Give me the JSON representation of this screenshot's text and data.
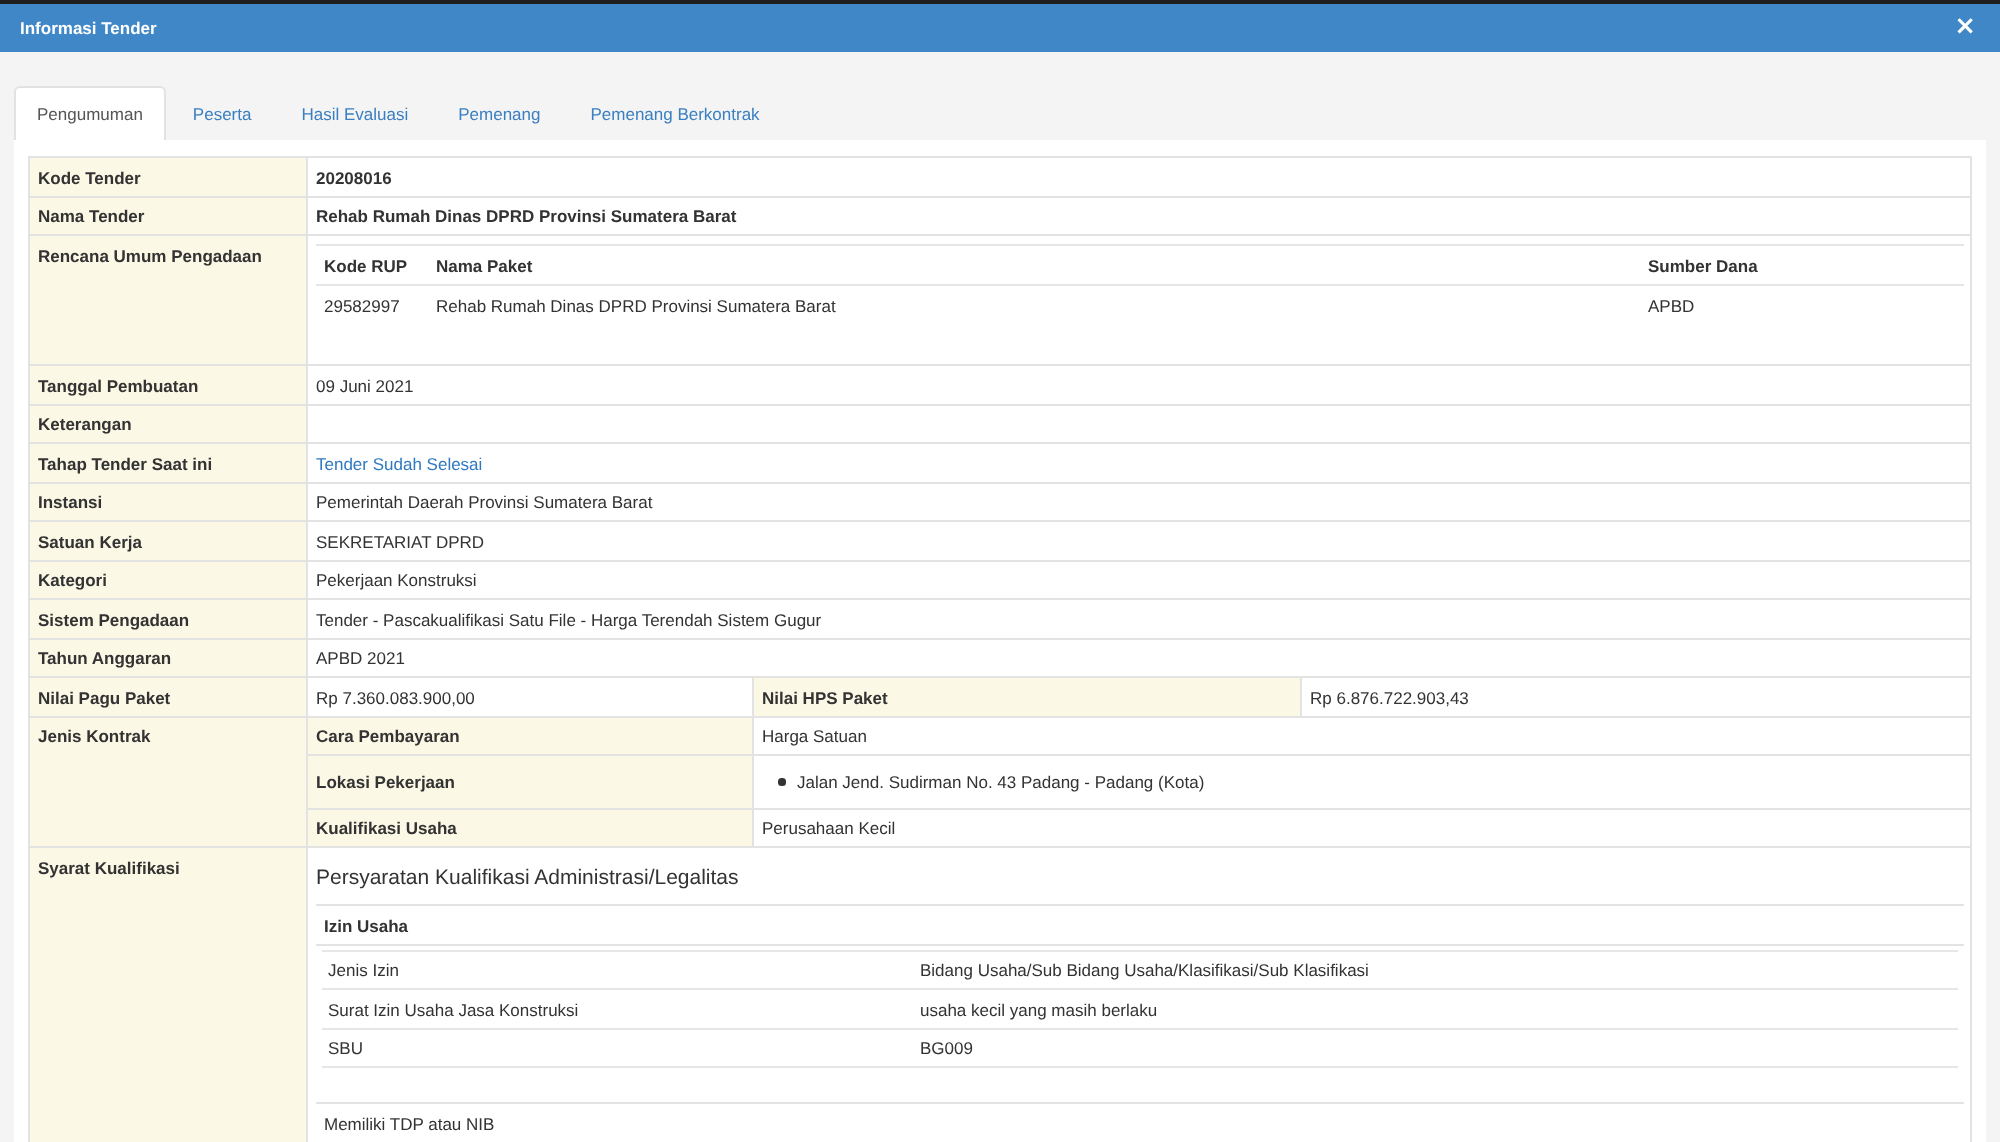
{
  "window": {
    "title": "Informasi Tender",
    "close": "×"
  },
  "tabs": [
    {
      "label": "Pengumuman",
      "selected": true
    },
    {
      "label": "Peserta",
      "selected": false
    },
    {
      "label": "Hasil Evaluasi",
      "selected": false
    },
    {
      "label": "Pemenang",
      "selected": false
    },
    {
      "label": "Pemenang Berkontrak",
      "selected": false
    }
  ],
  "details": [
    {
      "kind": "strong",
      "label": "Kode Tender",
      "value": "20208016"
    },
    {
      "kind": "strong",
      "label": "Nama Tender",
      "value": "Rehab Rumah Dinas DPRD Provinsi Sumatera Barat"
    },
    {
      "kind": "table",
      "label": "Rencana Umum Pengadaan",
      "columns": [
        "Kode RUP",
        "Nama Paket",
        "Sumber Dana"
      ],
      "rows": [
        [
          "29582997",
          "Rehab Rumah Dinas DPRD Provinsi Sumatera Barat",
          "APBD"
        ]
      ]
    },
    {
      "kind": "text",
      "label": "Tanggal Pembuatan",
      "value": "09 Juni 2021"
    },
    {
      "kind": "text",
      "label": "Keterangan"
    },
    {
      "kind": "link",
      "label": "Tahap Tender Saat ini",
      "value": "Tender Sudah Selesai"
    },
    {
      "kind": "text",
      "label": "Instansi",
      "value": "Pemerintah Daerah Provinsi Sumatera Barat"
    },
    {
      "kind": "text",
      "label": "Satuan Kerja",
      "value": "SEKRETARIAT DPRD"
    },
    {
      "kind": "text",
      "label": "Kategori",
      "value": "Pekerjaan Konstruksi"
    },
    {
      "kind": "text",
      "label": "Sistem Pengadaan",
      "value": "Tender - Pascakualifikasi Satu File - Harga Terendah Sistem Gugur"
    },
    {
      "kind": "text",
      "label": "Tahun Anggaran",
      "value": "APBD 2021"
    },
    {
      "kind": "pair",
      "label": "Nilai Pagu Paket",
      "value": "Rp 7.360.083.900,00",
      "second_label": "Nilai HPS Paket",
      "second_value": "Rp 6.876.722.903,43"
    },
    {
      "kind": "group",
      "label": "Jenis Kontrak",
      "items": [
        {
          "kind": "text",
          "label": "Cara Pembayaran",
          "value": "Harga Satuan"
        },
        {
          "kind": "list",
          "label": "Lokasi Pekerjaan",
          "values": [
            "Jalan Jend. Sudirman No. 43 Padang - Padang (Kota)"
          ]
        },
        {
          "kind": "text",
          "label": "Kualifikasi Usaha",
          "value": "Perusahaan Kecil"
        }
      ]
    },
    {
      "kind": "requirements",
      "label": "Syarat Kualifikasi",
      "heading": "Persyaratan Kualifikasi Administrasi/Legalitas",
      "sections": [
        {
          "title": "Izin Usaha",
          "rows": [
            [
              "Jenis Izin",
              "Bidang Usaha/Sub Bidang Usaha/Klasifikasi/Sub Klasifikasi"
            ],
            [
              "Surat Izin Usaha Jasa Konstruksi",
              "usaha kecil yang masih berlaku"
            ],
            [
              "SBU",
              "BG009"
            ]
          ]
        }
      ],
      "notes": [
        "Memiliki TDP atau NIB"
      ]
    }
  ]
}
